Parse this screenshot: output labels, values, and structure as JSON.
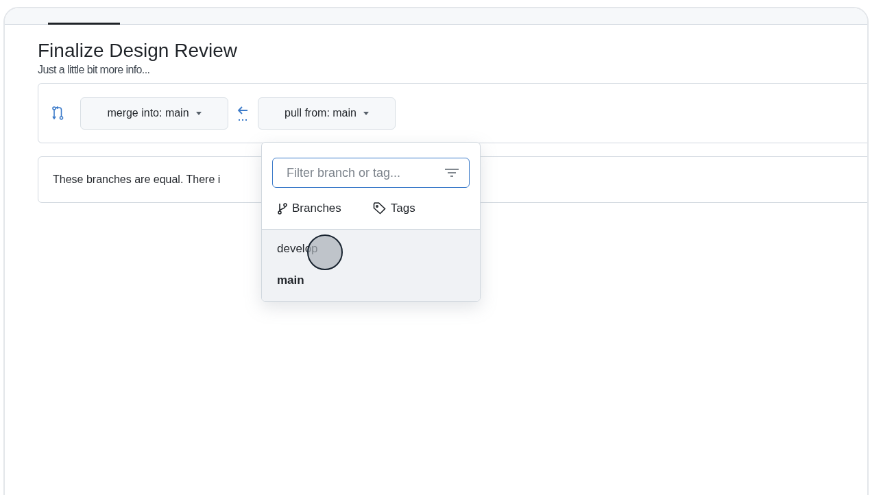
{
  "title": "Finalize Design Review",
  "subtitle": "Just a little bit more info...",
  "compare": {
    "base_button": "merge into: main",
    "head_button": "pull from: main"
  },
  "message": "These branches are equal. There i",
  "dropdown": {
    "filter": {
      "placeholder": "Filter branch or tag..."
    },
    "tabs": [
      {
        "label": "Branches",
        "kind": "branch"
      },
      {
        "label": "Tags",
        "kind": "tag"
      }
    ],
    "items": [
      {
        "label": "develop",
        "selected": false
      },
      {
        "label": "main",
        "selected": true
      }
    ]
  }
}
